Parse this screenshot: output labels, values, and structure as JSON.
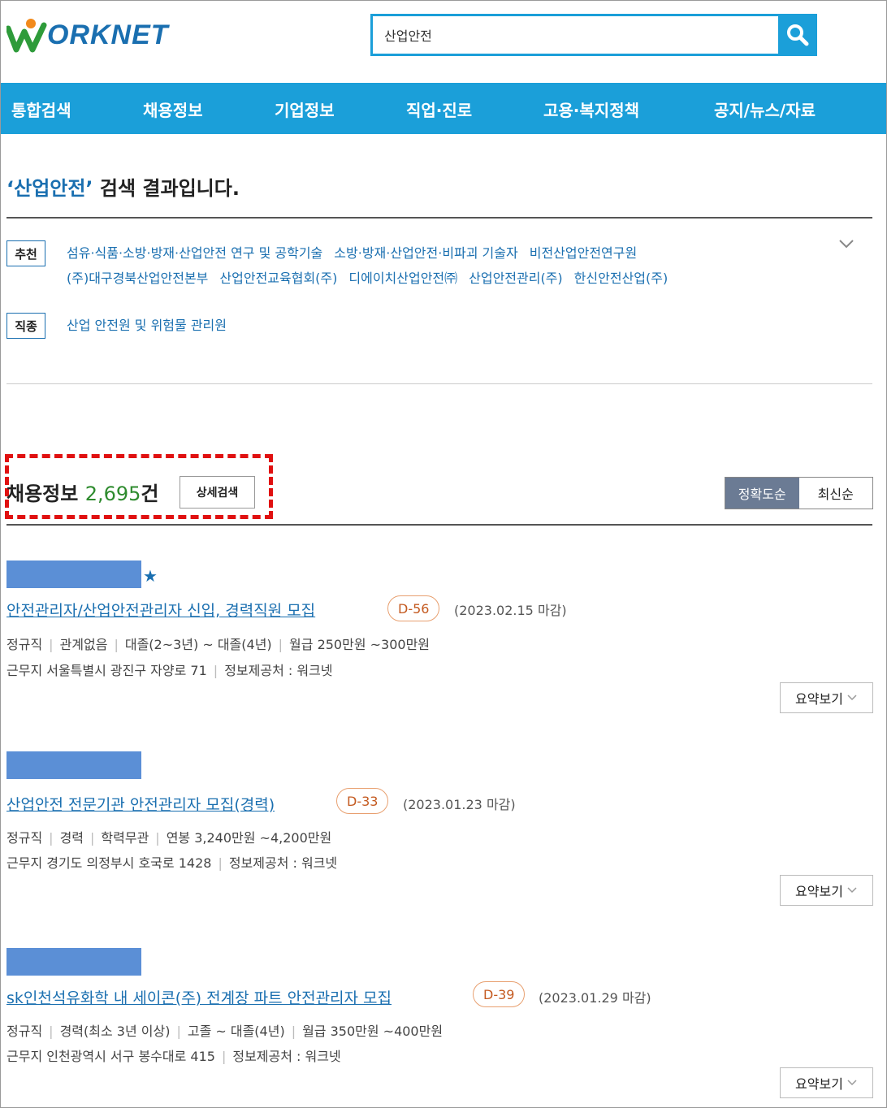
{
  "header": {
    "logo_text": "ORKNET",
    "search_value": "산업안전"
  },
  "nav": {
    "items": [
      {
        "label": "통합검색"
      },
      {
        "label": "채용정보"
      },
      {
        "label": "기업정보"
      },
      {
        "label": "직업·진로"
      },
      {
        "label": "고용·복지정책"
      },
      {
        "label": "공지/뉴스/자료"
      }
    ]
  },
  "results": {
    "keyword": "‘산업안전’",
    "suffix": " 검색 결과입니다."
  },
  "recommend": {
    "tag": "추천",
    "line1": [
      "섬유·식품·소방·방재·산업안전 연구 및 공학기술",
      "소방·방재·산업안전·비파괴 기술자",
      "비전산업안전연구원"
    ],
    "line2": [
      "(주)대구경북산업안전본부",
      "산업안전교육협회(주)",
      "디에이치산업안전㈜",
      "산업안전관리(주)",
      "한신안전산업(주)"
    ]
  },
  "occupation": {
    "tag": "직종",
    "items": [
      "산업 안전원 및 위험물 관리원"
    ]
  },
  "jobs_section": {
    "label": "채용정보",
    "count": "2,695",
    "unit": "건",
    "detail_search": "상세검색",
    "sort_accuracy": "정확도순",
    "sort_latest": "최신순"
  },
  "jobs": [
    {
      "title": "안전관리자/산업안전관리자 신입, 경력직원 모집",
      "dday": "D-56",
      "deadline": "(2023.02.15 마감)",
      "meta1": [
        "정규직",
        "관계없음",
        "대졸(2~3년) ~ 대졸(4년)",
        "월급 250만원 ~300만원"
      ],
      "meta2": [
        "근무지 서울특별시 광진구 자양로 71",
        "정보제공처 : 워크넷"
      ],
      "summary": "요약보기"
    },
    {
      "title": "산업안전 전문기관 안전관리자 모집(경력)",
      "dday": "D-33",
      "deadline": "(2023.01.23 마감)",
      "meta1": [
        "정규직",
        "경력",
        "학력무관",
        "연봉 3,240만원 ~4,200만원"
      ],
      "meta2": [
        "근무지 경기도 의정부시 호국로 1428",
        "정보제공처 : 워크넷"
      ],
      "summary": "요약보기"
    },
    {
      "title": "sk인천석유화학 내 세이콘(주) 전계장 파트 안전관리자 모집",
      "dday": "D-39",
      "deadline": "(2023.01.29 마감)",
      "meta1": [
        "정규직",
        "경력(최소 3년 이상)",
        "고졸 ~ 대졸(4년)",
        "월급 350만원 ~400만원"
      ],
      "meta2": [
        "근무지 인천광역시 서구 봉수대로 415",
        "정보제공처 : 워크넷"
      ],
      "summary": "요약보기"
    }
  ],
  "colors": {
    "brand_blue": "#1b9fd9",
    "link_blue": "#1a6fb0",
    "count_green": "#2e8b2e",
    "highlight_red": "#e01010",
    "dday_orange": "#c45a20"
  }
}
